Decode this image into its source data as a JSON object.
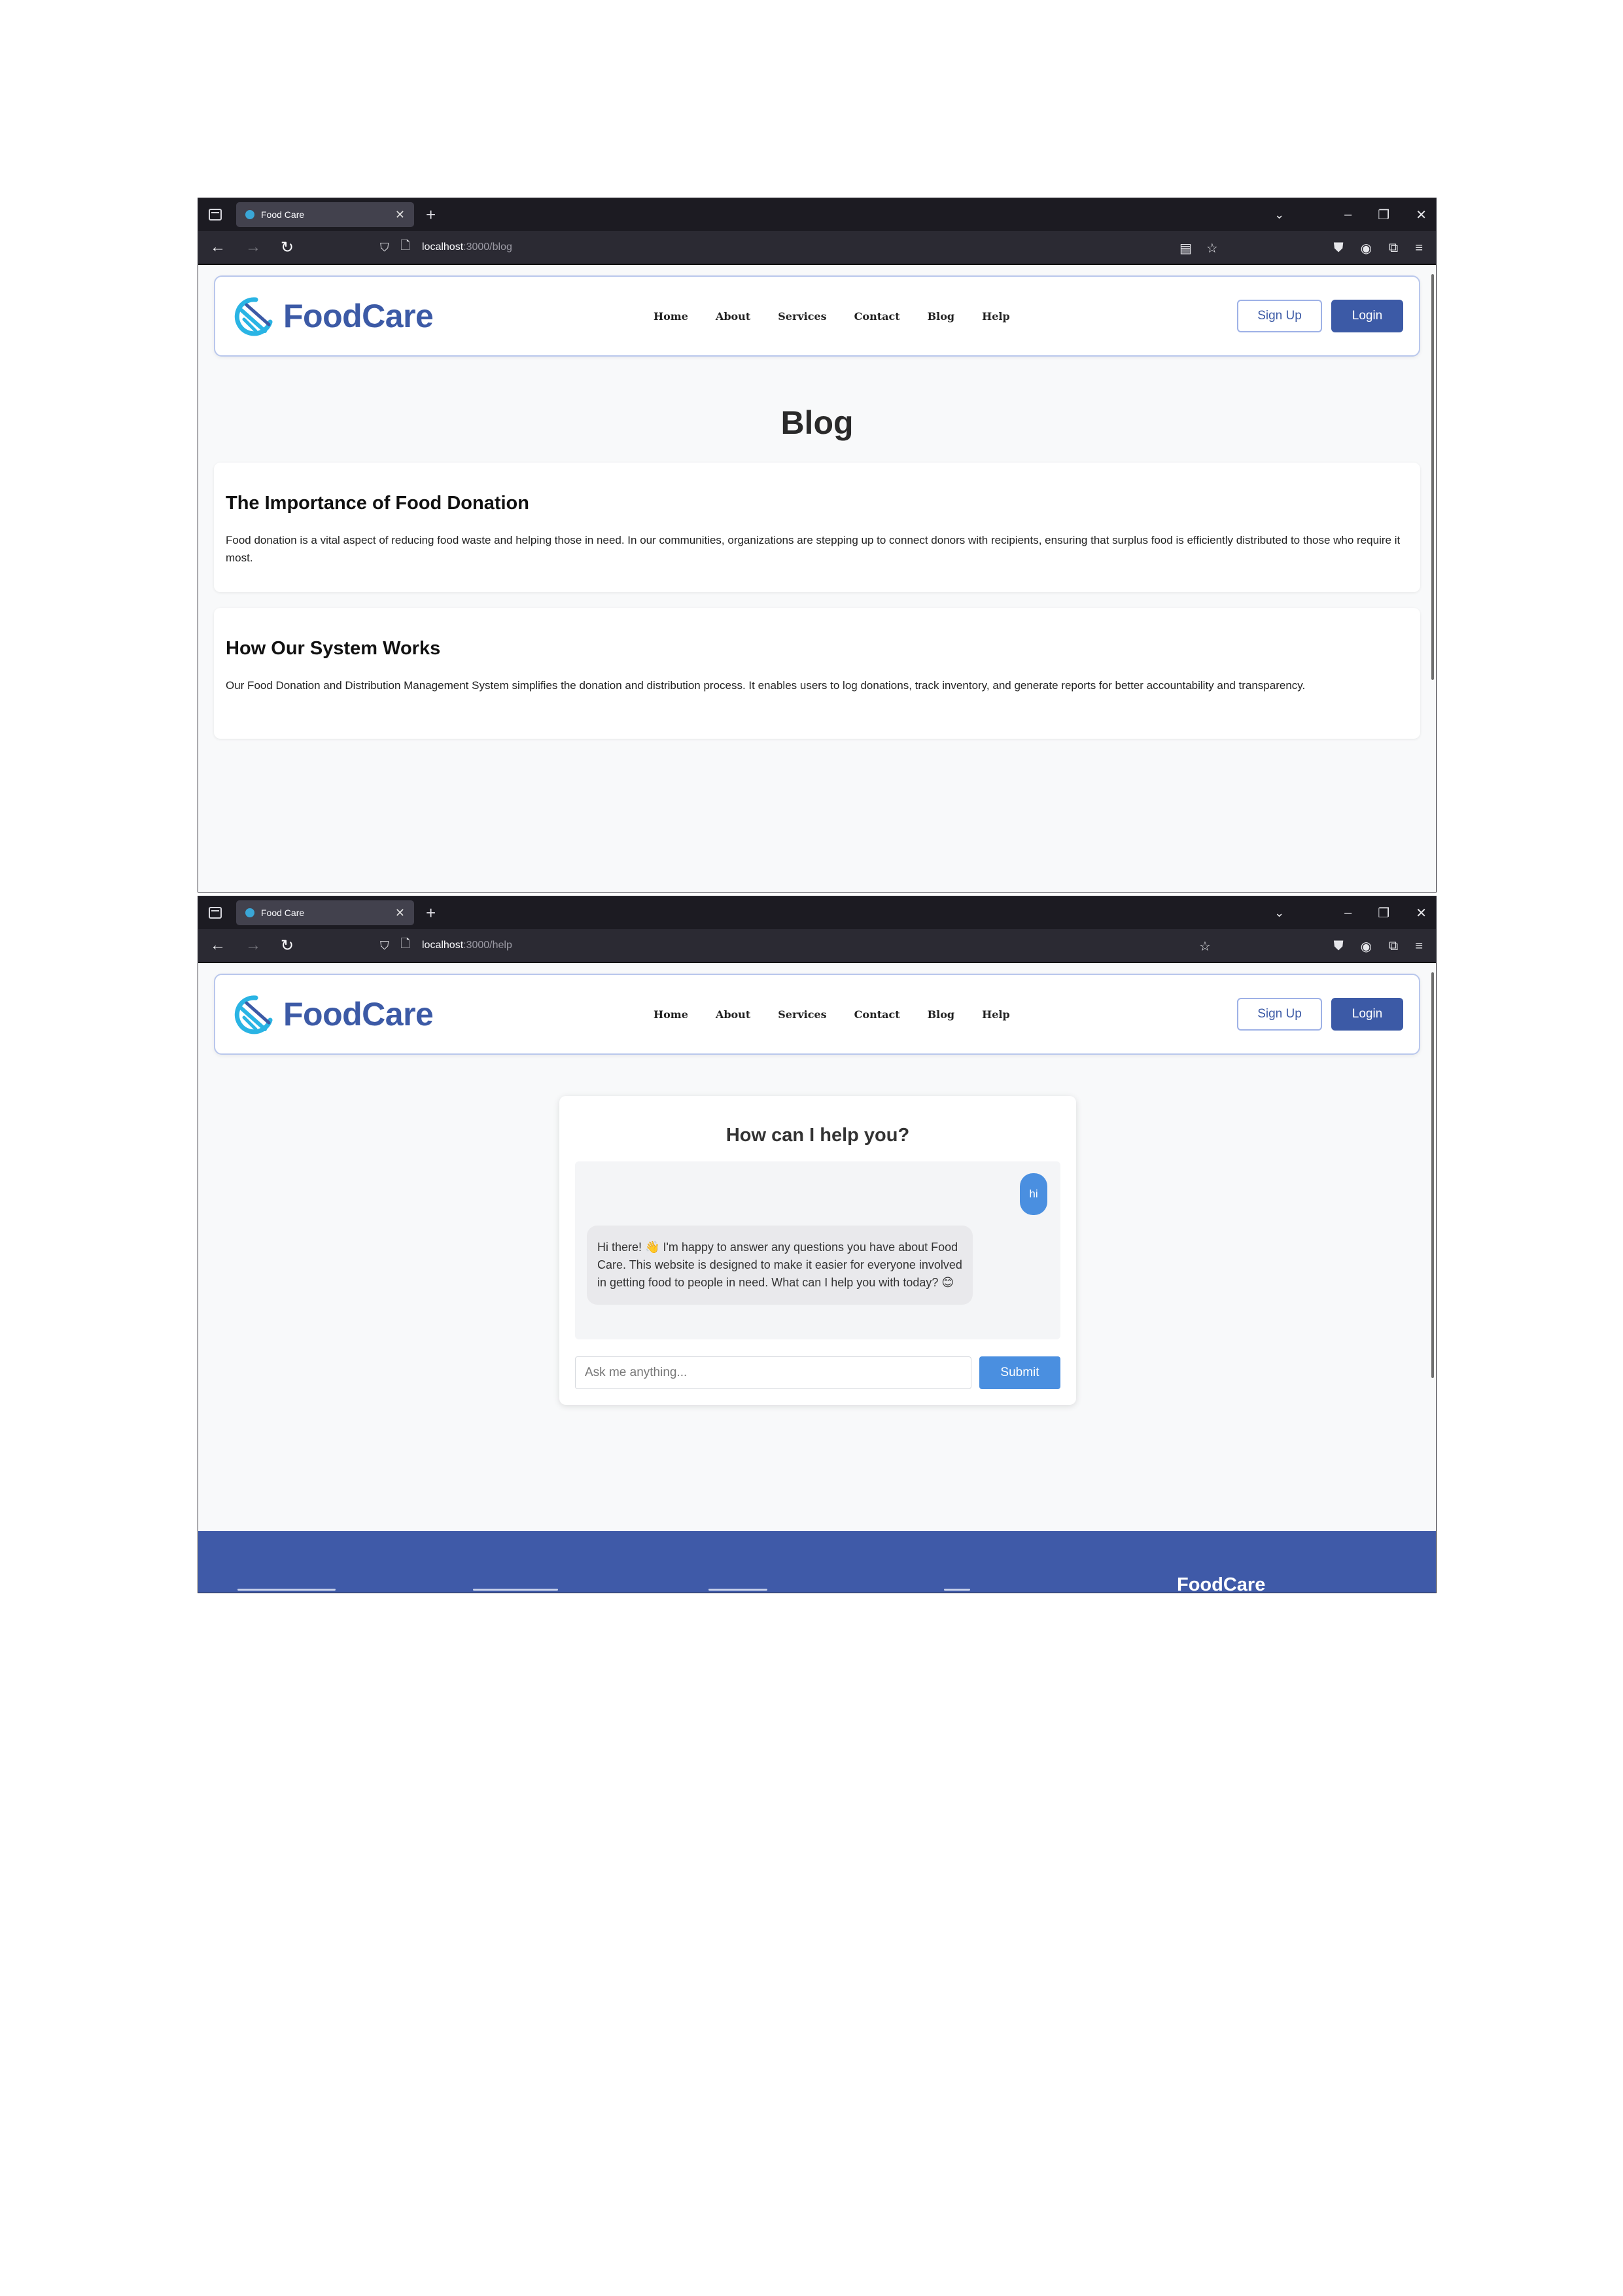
{
  "browser": {
    "tab_title": "Food Care",
    "url_host": "localhost",
    "blog_url_path": ":3000/blog",
    "help_url_path": ":3000/help"
  },
  "site": {
    "logo_text": "FoodCare",
    "logo_color": "#3c5aa6",
    "accent_color": "#4a8fe0",
    "nav": [
      "Home",
      "About",
      "Services",
      "Contact",
      "Blog",
      "Help"
    ],
    "signup_label": "Sign Up",
    "login_label": "Login"
  },
  "blog": {
    "title": "Blog",
    "posts": [
      {
        "title": "The Importance of Food Donation",
        "body": "Food donation is a vital aspect of reducing food waste and helping those in need. In our communities, organizations are stepping up to connect donors with recipients, ensuring that surplus food is efficiently distributed to those who require it most."
      },
      {
        "title": "How Our System Works",
        "body": "Our Food Donation and Distribution Management System simplifies the donation and distribution process. It enables users to log donations, track inventory, and generate reports for better accountability and transparency."
      }
    ]
  },
  "help": {
    "heading": "How can I help you?",
    "user_message": "hi",
    "bot_message": "Hi there! 👋 I'm happy to answer any questions you have about Food Care. This website is designed to make it easier for everyone involved in getting food to people in need. What can I help you with today? 😊",
    "input_placeholder": "Ask me anything...",
    "submit_label": "Submit"
  },
  "footer": {
    "brand": "FoodCare",
    "color": "#3f5aa8"
  }
}
